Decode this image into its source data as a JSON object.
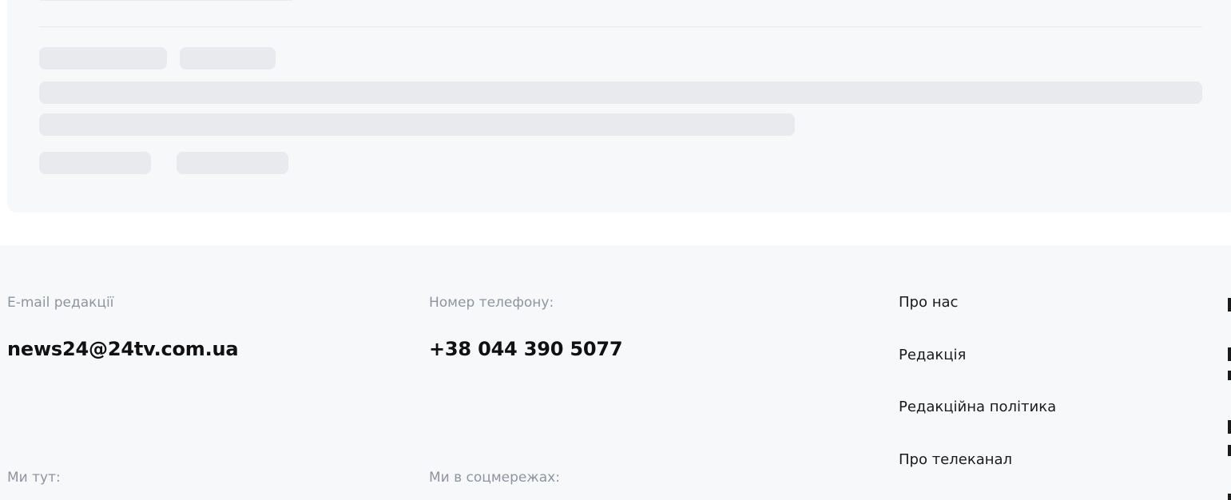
{
  "footer": {
    "email_label": "E-mail редакції",
    "email_value": "news24@24tv.com.ua",
    "phone_label": "Номер телефону:",
    "phone_value": "+38 044 390 5077",
    "location_label": "Ми тут:",
    "social_label": "Ми в соцмережах:",
    "links": [
      {
        "label": "Про нас"
      },
      {
        "label": "Редакція"
      },
      {
        "label": "Редакційна політика"
      },
      {
        "label": "Про телеканал"
      }
    ]
  },
  "colors": {
    "card_bg": "#f7f8fa",
    "skeleton": "#e8eaed",
    "label_gray": "#8e959f",
    "text_dark": "#111111"
  }
}
